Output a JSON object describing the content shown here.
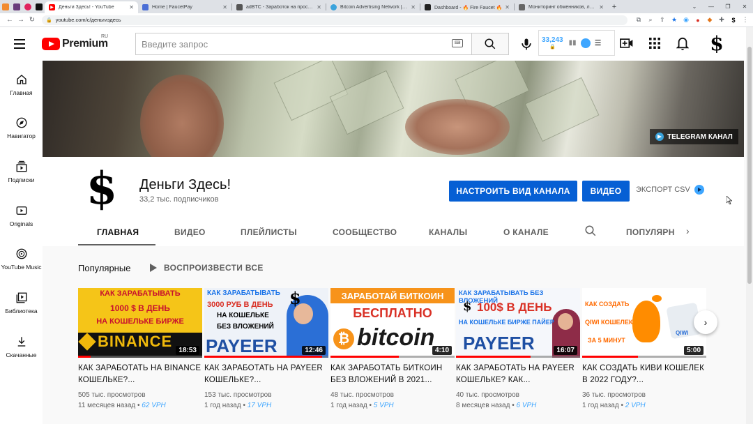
{
  "browser": {
    "tabs": [
      {
        "title": "Деньги Здесь! - YouTube",
        "color": "#ff0000",
        "active": true
      },
      {
        "title": "Home | FaucetPay",
        "color": "#4b6fd6",
        "active": false
      },
      {
        "title": "adBTC - Заработок на просмотр",
        "color": "#555555",
        "active": false
      },
      {
        "title": "Bitcoin Advertising Network | CO",
        "color": "#3aa3dc",
        "active": false
      },
      {
        "title": "Dashboard - 🔥 Fire Faucet 🔥",
        "color": "#222222",
        "active": false
      },
      {
        "title": "Мониторинг обменников, лучш",
        "color": "#666666",
        "active": false
      }
    ],
    "url": "youtube.com/c/деньгиздесь"
  },
  "masthead": {
    "logo_text": "Premium",
    "region": "RU",
    "search_placeholder": "Введите запрос",
    "stats_number": "33,243",
    "colors": {
      "brand": "#ff0000",
      "accent": "#065fd4"
    }
  },
  "guide": [
    {
      "label": "Главная",
      "icon": "home-icon"
    },
    {
      "label": "Навигатор",
      "icon": "compass-icon"
    },
    {
      "label": "Подписки",
      "icon": "subscriptions-icon"
    },
    {
      "label": "Originals",
      "icon": "originals-icon"
    },
    {
      "label": "YouTube Music",
      "icon": "music-icon"
    },
    {
      "label": "Библиотека",
      "icon": "library-icon"
    },
    {
      "label": "Скачанные",
      "icon": "download-icon"
    }
  ],
  "banner": {
    "link_label": "TELEGRAM КАНАЛ"
  },
  "channel": {
    "avatar_glyph": "$",
    "name": "Деньги Здесь!",
    "subscribers": "33,2 тыс. подписчиков",
    "customize_button": "НАСТРОИТЬ ВИД КАНАЛА",
    "video_button": "ВИДЕО",
    "export_label": "ЭКСПОРТ CSV"
  },
  "tabs": [
    {
      "label": "ГЛАВНАЯ",
      "active": true
    },
    {
      "label": "ВИДЕО",
      "active": false
    },
    {
      "label": "ПЛЕЙЛИСТЫ",
      "active": false
    },
    {
      "label": "СООБЩЕСТВО",
      "active": false
    },
    {
      "label": "КАНАЛЫ",
      "active": false
    },
    {
      "label": "О КАНАЛЕ",
      "active": false
    },
    {
      "label": "ПОПУЛЯРНЫ",
      "active": false
    }
  ],
  "shelf": {
    "title": "Популярные",
    "play_all": "ВОСПРОИЗВЕСТИ ВСЕ"
  },
  "videos": [
    {
      "title": "КАК ЗАРАБОТАТЬ НА BINANCE КОШЕЛЬКЕ?...",
      "views": "505 тыс. просмотров",
      "age": "11 месяцев назад",
      "vph": "62 VPH",
      "duration": "18:53",
      "watched": 0.1,
      "thumb_lines": [
        "КАК ЗАРАБАТЫВАТЬ",
        "1000 $ В ДЕНЬ",
        "НА КОШЕЛЬКЕ БИРЖЕ",
        "BINANCE"
      ]
    },
    {
      "title": "КАК ЗАРАБОТАТЬ НА PAYEER КОШЕЛЬКЕ?...",
      "views": "153 тыс. просмотров",
      "age": "1 год назад",
      "vph": "17 VPH",
      "duration": "12:46",
      "watched": 0.95,
      "thumb_lines": [
        "КАК ЗАРАБАТЫВАТЬ",
        "3000 РУБ В ДЕНЬ",
        "НА КОШЕЛЬКЕ",
        "БЕЗ ВЛОЖЕНИЙ",
        "PAYEER"
      ]
    },
    {
      "title": "КАК ЗАРАБОТАТЬ БИТКОИН БЕЗ ВЛОЖЕНИЙ В 2021...",
      "views": "48 тыс. просмотров",
      "age": "1 год назад",
      "vph": "5 VPH",
      "duration": "4:10",
      "watched": 0.55,
      "thumb_lines": [
        "ЗАРАБОТАЙ БИТКОИН",
        "БЕСПЛАТНО",
        "bitcoin"
      ]
    },
    {
      "title": "КАК ЗАРАБОТАТЬ НА PAYEER КОШЕЛЬКЕ? КАК...",
      "views": "40 тыс. просмотров",
      "age": "8 месяцев назад",
      "vph": "6 VPH",
      "duration": "16:07",
      "watched": 0.6,
      "thumb_lines": [
        "КАК ЗАРАБАТЫВАТЬ БЕЗ ВЛОЖЕНИЙ",
        "100$ В ДЕНЬ",
        "НА КОШЕЛЬКЕ БИРЖЕ ПАЙЕР",
        "PAYEER"
      ]
    },
    {
      "title": "КАК СОЗДАТЬ КИВИ КОШЕЛЕК В 2022 ГОДУ?...",
      "views": "36 тыс. просмотров",
      "age": "1 год назад",
      "vph": "2 VPH",
      "duration": "5:00",
      "watched": 0.45,
      "thumb_lines": [
        "КАК СОЗДАТЬ",
        "QIWI КОШЕЛЕК",
        "ЗА 5 МИНУТ",
        "QIWI"
      ]
    }
  ]
}
